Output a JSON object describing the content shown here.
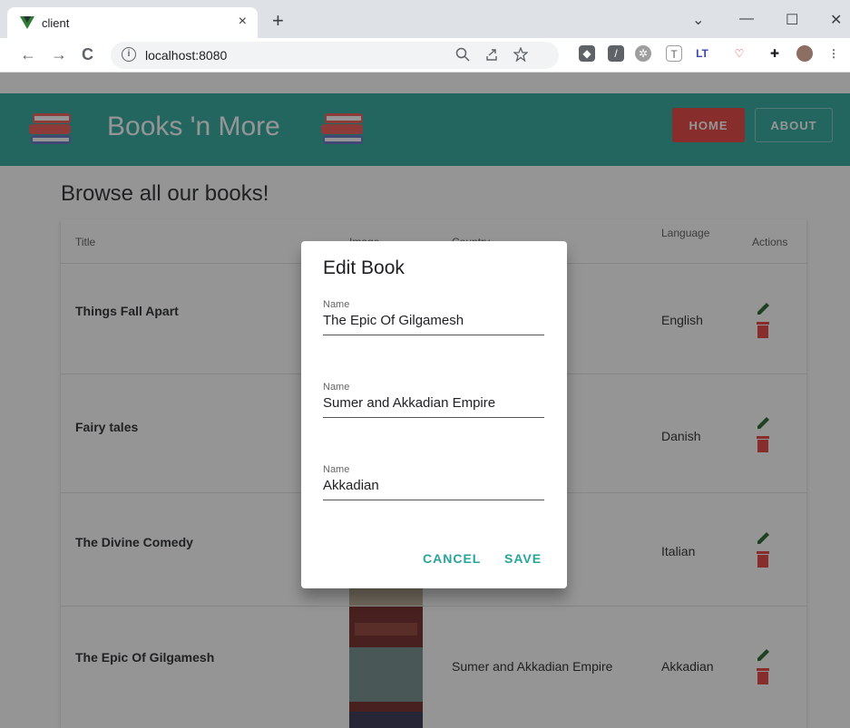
{
  "browser": {
    "tab_title": "client",
    "tab_close": "×",
    "new_tab": "+",
    "url": "localhost:8080",
    "back": "←",
    "forward": "→",
    "reload": "C",
    "info": "i",
    "minimize": "—",
    "maximize": "☐",
    "close": "✕",
    "chevron": "⌄"
  },
  "app": {
    "brand": "Books 'n More",
    "nav": {
      "home": "HOME",
      "about": "ABOUT"
    },
    "heading": "Browse all our books!",
    "colors": {
      "primary": "#26a69a",
      "danger": "#e53935"
    }
  },
  "table": {
    "headers": {
      "title": "Title",
      "image": "Image",
      "country": "Country",
      "language": "Language",
      "actions": "Actions"
    },
    "rows": [
      {
        "title": "Things Fall Apart",
        "country": "",
        "language": "English"
      },
      {
        "title": "Fairy tales",
        "country": "",
        "language": "Danish"
      },
      {
        "title": "The Divine Comedy",
        "country": "",
        "language": "Italian"
      },
      {
        "title": "The Epic Of Gilgamesh",
        "country": "Sumer and Akkadian Empire",
        "language": "Akkadian"
      }
    ]
  },
  "dialog": {
    "title": "Edit Book",
    "fields": [
      {
        "label": "Name",
        "value": "The Epic Of Gilgamesh"
      },
      {
        "label": "Name",
        "value": "Sumer and Akkadian Empire"
      },
      {
        "label": "Name",
        "value": "Akkadian"
      }
    ],
    "cancel": "CANCEL",
    "save": "SAVE"
  }
}
